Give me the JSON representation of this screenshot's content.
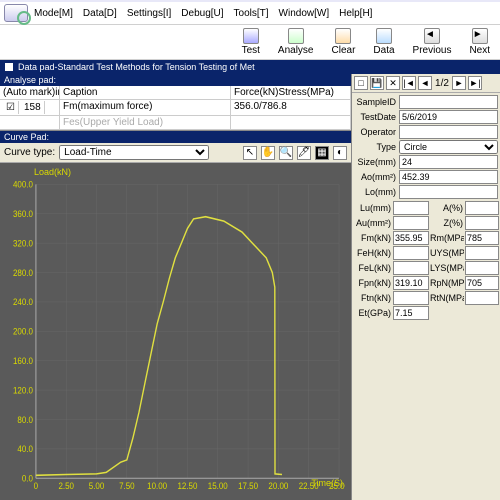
{
  "menu": {
    "mode": "Mode[M]",
    "data": "Data[D]",
    "settings": "Settings[I]",
    "debug": "Debug[U]",
    "tools": "Tools[T]",
    "window": "Window[W]",
    "help": "Help[H]"
  },
  "toolbar": {
    "test": "Test",
    "analyse": "Analyse",
    "clear": "Clear",
    "data": "Data",
    "previous": "Previous",
    "next": "Next"
  },
  "data_pad_title": "Data pad-Standard Test Methods for Tension Testing of Met",
  "analyse_pad": {
    "title": "Analyse pad:",
    "headers": {
      "col0": "(Auto mark)in..",
      "col1": "Caption",
      "col2": "Force(kN)Stress(MPa)"
    },
    "row": {
      "check": "☑",
      "idx": "158",
      "caption": "Fm(maximum force)",
      "value": "356.0/786.8"
    },
    "row2": {
      "caption": "Fes(Upper Yield Load)"
    }
  },
  "curve": {
    "title": "Curve Pad:",
    "type_label": "Curve type:",
    "type_value": "Load-Time",
    "y_axis": "Load(kN)",
    "x_axis": "Time(S)"
  },
  "nav": {
    "page": "1/2"
  },
  "form": {
    "sampleid_l": "SampleID",
    "sampleid_v": "",
    "testdate_l": "TestDate",
    "testdate_v": "5/6/2019",
    "operator_l": "Operator",
    "operator_v": "",
    "type_l": "Type",
    "type_v": "Circle",
    "size_l": "Size(mm)",
    "size_v": "24",
    "ao_l": "Ao(mm²)",
    "ao_v": "452.39",
    "lo_l": "Lo(mm)",
    "lo_v": "",
    "lu_l": "Lu(mm)",
    "lu_v": "",
    "a_l": "A(%)",
    "a_v": "",
    "au_l": "Au(mm²)",
    "au_v": "",
    "z_l": "Z(%)",
    "z_v": "",
    "fm_l": "Fm(kN)",
    "fm_v": "355.95",
    "rm_l": "Rm(MPa)",
    "rm_v": "785",
    "feh_l": "FeH(kN)",
    "feh_v": "",
    "uys_l": "UYS(MPa)",
    "uys_v": "",
    "fel_l": "FeL(kN)",
    "fel_v": "",
    "lys_l": "LYS(MPa)",
    "lys_v": "",
    "fpn_l": "Fpn(kN)",
    "fpn_v": "319.10",
    "rpn_l": "RpN(MPa)",
    "rpn_v": "705",
    "ftn_l": "Ftn(kN)",
    "ftn_v": "",
    "rtn_l": "RtN(MPa)",
    "rtn_v": "",
    "et_l": "Et(GPa)",
    "et_v": "7.15"
  },
  "chart_data": {
    "type": "line",
    "title": "Load(kN)",
    "xlabel": "Time(S)",
    "ylabel": "Load(kN)",
    "xlim": [
      0,
      25
    ],
    "ylim": [
      0,
      400
    ],
    "xticks": [
      0,
      2.5,
      5.0,
      7.5,
      10.0,
      12.5,
      15.0,
      17.5,
      20.0,
      22.5,
      25.0
    ],
    "yticks": [
      0,
      40,
      80,
      120,
      160,
      200,
      240,
      280,
      320,
      360,
      400
    ],
    "x": [
      0,
      2.5,
      5.0,
      5.8,
      7.0,
      7.5,
      8.0,
      8.5,
      9.0,
      9.5,
      10.0,
      10.5,
      11.0,
      11.5,
      12.0,
      12.5,
      13.0,
      14.0,
      15.5,
      17.0,
      19.0,
      19.5,
      19.7,
      19.72,
      20.3
    ],
    "values": [
      4,
      5,
      6,
      8,
      22,
      25,
      55,
      90,
      130,
      170,
      210,
      240,
      272,
      300,
      320,
      340,
      353,
      356,
      350,
      335,
      300,
      280,
      260,
      6,
      5
    ]
  }
}
